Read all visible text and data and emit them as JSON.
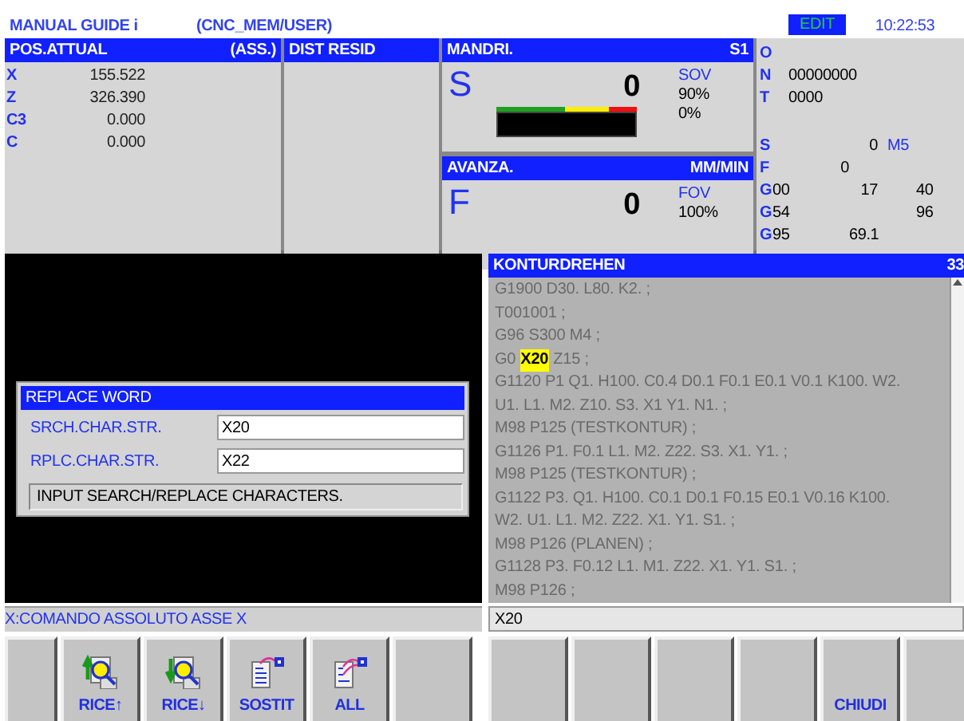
{
  "header": {
    "title": "MANUAL GUIDE i",
    "path": "(CNC_MEM/USER)",
    "mode": "EDIT",
    "time": "10:22:53"
  },
  "position": {
    "title": "POS.ATTUAL",
    "mode": "(ASS.)",
    "axes": [
      {
        "axis": "X",
        "value": "155.522"
      },
      {
        "axis": "Z",
        "value": "326.390"
      },
      {
        "axis": "C3",
        "value": "0.000"
      },
      {
        "axis": "C",
        "value": "0.000"
      }
    ]
  },
  "distance": {
    "title": "DIST RESID"
  },
  "spindle": {
    "title": "MANDRI.",
    "channel": "S1",
    "letter": "S",
    "value": "0",
    "override_label": "SOV",
    "override": "90%",
    "load_reading": "0%",
    "load": {
      "level": 0
    }
  },
  "feed": {
    "title": "AVANZA.",
    "unit": "MM/MIN",
    "letter": "F",
    "value": "0",
    "override_label": "FOV",
    "override": "100%"
  },
  "program_info": [
    {
      "label": "O"
    },
    {
      "label": "N",
      "value": "00000000"
    },
    {
      "label": "T",
      "value": "0000"
    }
  ],
  "modal_states": [
    {
      "label": "S",
      "column_2": "0",
      "column_3": "M5"
    },
    {
      "label": "F",
      "column_1": "0"
    },
    {
      "label": "G",
      "code": "00",
      "column_2": "17",
      "column_4": "40"
    },
    {
      "label": "G",
      "code": "54",
      "column_4": "96"
    },
    {
      "label": "G",
      "code": "95",
      "column_2": "69.1"
    }
  ],
  "dialog": {
    "title": "REPLACE WORD",
    "fields": [
      {
        "label": "SRCH.CHAR.STR.",
        "value": "X20"
      },
      {
        "label": "RPLC.CHAR.STR.",
        "value": "X22"
      }
    ],
    "message": "INPUT SEARCH/REPLACE CHARACTERS."
  },
  "program": {
    "title": "KONTURDREHEN",
    "number": "33",
    "lines": [
      [
        {
          "text": "G1900 D30. L80. K2. ;",
          "highlighted": false
        }
      ],
      [
        {
          "text": "T001001 ;",
          "highlighted": false
        }
      ],
      [
        {
          "text": "G96 S300 M4 ;",
          "highlighted": false
        }
      ],
      [
        {
          "text": "G0",
          "highlighted": false
        },
        {
          "text": "X20",
          "highlighted": true
        },
        {
          "text": "Z15 ;",
          "highlighted": false
        }
      ],
      [
        {
          "text": "G1120 P1 Q1. H100. C0.4 D0.1 F0.1 E0.1 V0.1 K100. W2.",
          "highlighted": false
        }
      ],
      [
        {
          "text": "U1. L1. M2. Z10. S3. X1 Y1. N1. ;",
          "highlighted": false
        }
      ],
      [
        {
          "text": "M98 P125 (TESTKONTUR) ;",
          "highlighted": false
        }
      ],
      [
        {
          "text": "G1126 P1. F0.1 L1. M2. Z22. S3. X1. Y1. ;",
          "highlighted": false
        }
      ],
      [
        {
          "text": "M98 P125 (TESTKONTUR) ;",
          "highlighted": false
        }
      ],
      [
        {
          "text": "G1122 P3. Q1. H100. C0.1 D0.1 F0.15 E0.1 V0.16 K100.",
          "highlighted": false
        }
      ],
      [
        {
          "text": "W2. U1. L1. M2. Z22. X1. Y1. S1. ;",
          "highlighted": false
        }
      ],
      [
        {
          "text": "M98 P126 (PLANEN) ;",
          "highlighted": false
        }
      ],
      [
        {
          "text": "G1128 P3. F0.12 L1. M1. Z22. X1. Y1. S1. ;",
          "highlighted": false
        }
      ],
      [
        {
          "text": "M98 P126 ;",
          "highlighted": false
        }
      ]
    ]
  },
  "message": "X:COMANDO ASSOLUTO ASSE X",
  "input": {
    "value": "X20"
  },
  "softkeys": [
    {
      "kind": "narrow"
    },
    {
      "kind": "search_up",
      "label": "RICE↑"
    },
    {
      "kind": "search_down",
      "label": "RICE↓"
    },
    {
      "kind": "replace",
      "label": "SOSTIT"
    },
    {
      "kind": "replace_all",
      "label": "ALL"
    },
    {
      "kind": "blank"
    },
    {
      "kind": "blank"
    },
    {
      "kind": "blank"
    },
    {
      "kind": "blank"
    },
    {
      "kind": "blank"
    },
    {
      "kind": "close",
      "label": "CHIUDI"
    },
    {
      "kind": "blank"
    }
  ]
}
